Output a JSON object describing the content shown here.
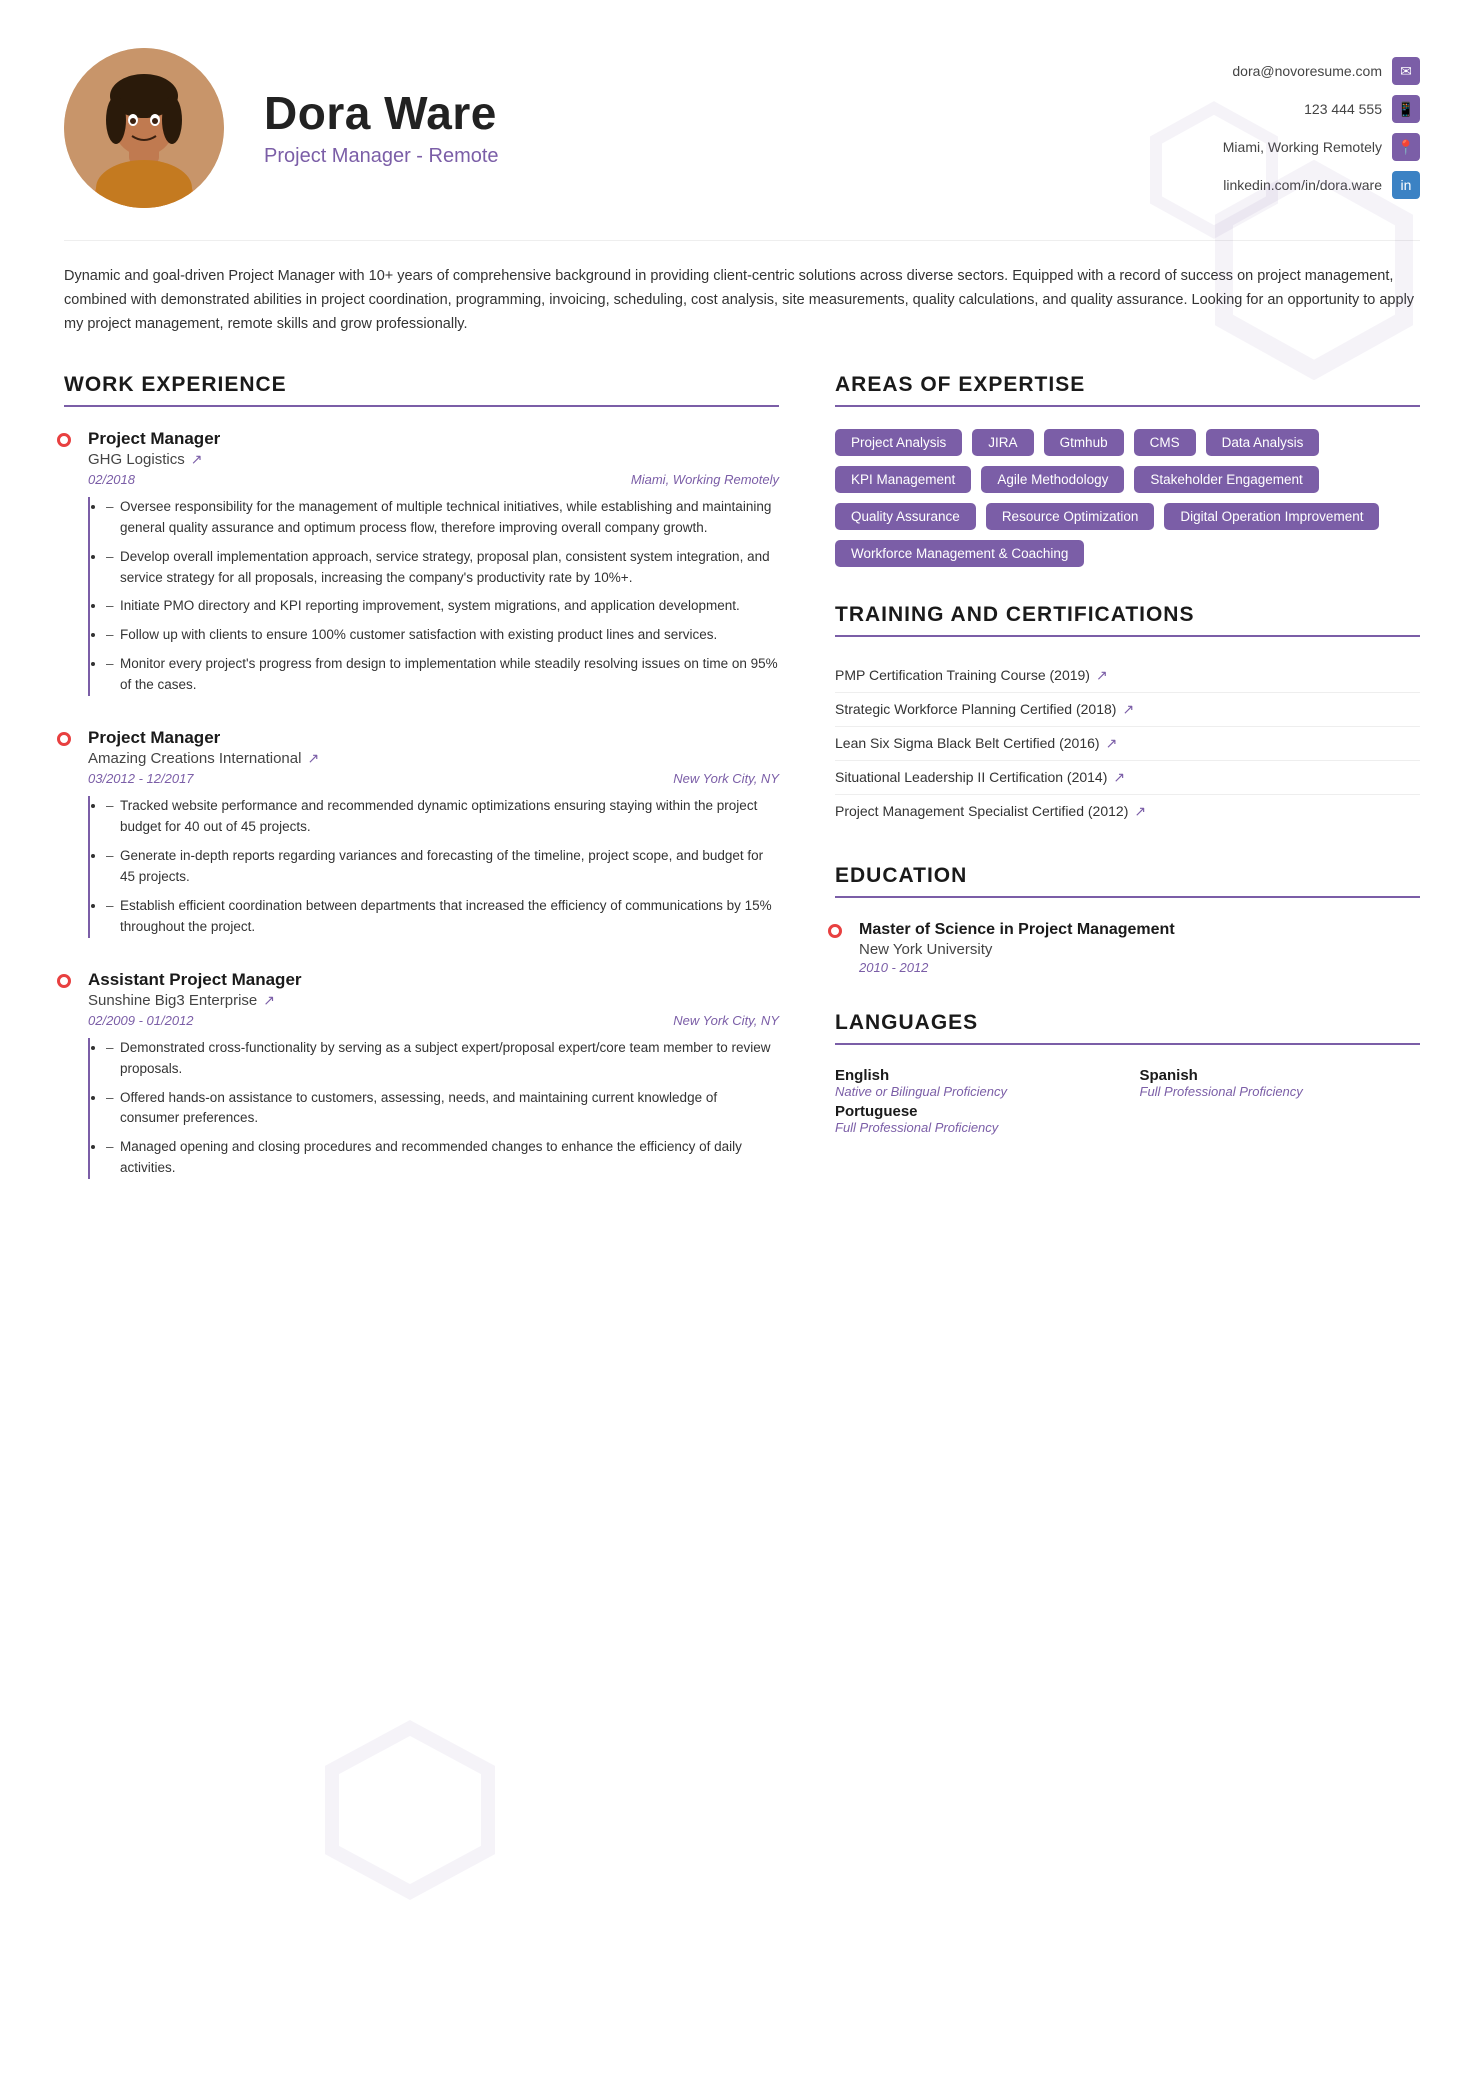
{
  "header": {
    "name": "Dora Ware",
    "title": "Project Manager - Remote",
    "avatar_alt": "Dora Ware photo",
    "contact": {
      "email": "dora@novoresume.com",
      "phone": "123 444 555",
      "location": "Miami, Working Remotely",
      "linkedin": "linkedin.com/in/dora.ware"
    }
  },
  "summary": "Dynamic and goal-driven Project Manager with 10+ years of comprehensive background in providing client-centric solutions across diverse sectors. Equipped with a record of success on project management, combined with demonstrated abilities in project coordination, programming, invoicing, scheduling, cost analysis, site measurements, quality calculations, and quality assurance. Looking for an opportunity to apply my project management, remote skills and grow professionally.",
  "sections": {
    "work_experience": {
      "title": "WORK EXPERIENCE",
      "jobs": [
        {
          "title": "Project Manager",
          "company": "GHG Logistics",
          "dates": "02/2018",
          "location": "Miami, Working Remotely",
          "bullets": [
            "Oversee responsibility for the management of multiple technical initiatives, while establishing and maintaining general quality assurance and optimum process flow, therefore improving overall company growth.",
            "Develop overall implementation approach, service strategy, proposal plan, consistent system integration, and service strategy for all proposals, increasing the company's productivity rate by 10%+.",
            "Initiate PMO directory and KPI reporting improvement, system migrations, and application development.",
            "Follow up with clients to ensure 100% customer satisfaction with existing product lines and services.",
            "Monitor every project's progress from design to implementation while steadily resolving issues on time on 95% of the cases."
          ]
        },
        {
          "title": "Project Manager",
          "company": "Amazing Creations International",
          "dates": "03/2012 - 12/2017",
          "location": "New York City, NY",
          "bullets": [
            "Tracked website performance and recommended dynamic optimizations ensuring staying within the project budget for 40 out of 45 projects.",
            "Generate in-depth reports regarding variances and forecasting of the timeline, project scope, and budget for 45 projects.",
            "Establish efficient coordination between departments that increased the efficiency of communications by 15% throughout the project."
          ]
        },
        {
          "title": "Assistant Project Manager",
          "company": "Sunshine Big3 Enterprise",
          "dates": "02/2009 - 01/2012",
          "location": "New York City, NY",
          "bullets": [
            "Demonstrated cross-functionality by serving as a subject expert/proposal expert/core team member to review proposals.",
            "Offered hands-on assistance to customers, assessing, needs, and maintaining current knowledge of consumer preferences.",
            "Managed opening and closing procedures and recommended changes to enhance the efficiency of daily activities."
          ]
        }
      ]
    },
    "areas_of_expertise": {
      "title": "AREAS OF EXPERTISE",
      "tags": [
        "Project Analysis",
        "JIRA",
        "Gtmhub",
        "CMS",
        "Data Analysis",
        "KPI Management",
        "Agile Methodology",
        "Stakeholder Engagement",
        "Quality Assurance",
        "Resource Optimization",
        "Digital Operation Improvement",
        "Workforce Management & Coaching"
      ]
    },
    "training": {
      "title": "TRAINING AND CERTIFICATIONS",
      "items": [
        "PMP Certification Training Course (2019)",
        "Strategic Workforce Planning Certified (2018)",
        "Lean Six Sigma Black Belt Certified (2016)",
        "Situational Leadership II Certification (2014)",
        "Project Management Specialist Certified (2012)"
      ]
    },
    "education": {
      "title": "EDUCATION",
      "items": [
        {
          "degree": "Master of Science in Project Management",
          "school": "New York University",
          "dates": "2010 - 2012"
        }
      ]
    },
    "languages": {
      "title": "LANGUAGES",
      "items": [
        {
          "name": "English",
          "level": "Native or Bilingual Proficiency"
        },
        {
          "name": "Spanish",
          "level": "Full Professional Proficiency"
        },
        {
          "name": "Portuguese",
          "level": "Full Professional Proficiency"
        }
      ]
    }
  },
  "labels": {
    "ext_link": "↗",
    "mail_icon": "✉",
    "phone_icon": "📱",
    "loc_icon": "📍",
    "li_icon": "in"
  }
}
